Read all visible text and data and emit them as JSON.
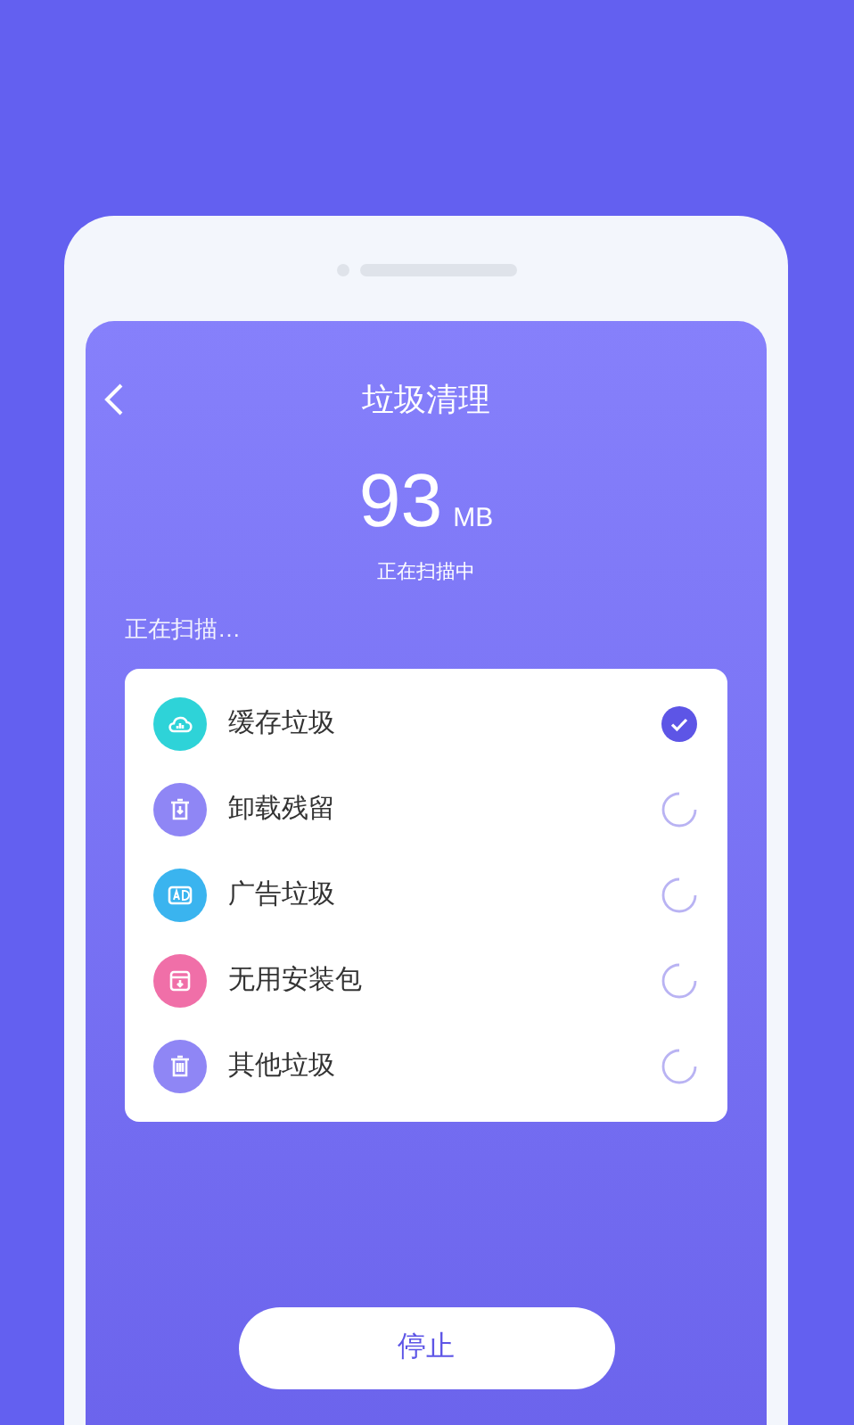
{
  "header": {
    "title": "垃圾清理"
  },
  "scan": {
    "amount": "93",
    "unit": "MB",
    "status": "正在扫描中",
    "progress_label": "正在扫描…"
  },
  "items": [
    {
      "label": "缓存垃圾",
      "kind": "cloud",
      "color": "#2ed3d8",
      "checked": true
    },
    {
      "label": "卸载残留",
      "kind": "uninstall",
      "color": "#8f86f5",
      "checked": false
    },
    {
      "label": "广告垃圾",
      "kind": "ad",
      "color": "#3ab4ef",
      "checked": false
    },
    {
      "label": "无用安装包",
      "kind": "package",
      "color": "#f06fa8",
      "checked": false
    },
    {
      "label": "其他垃圾",
      "kind": "trash",
      "color": "#8f86f5",
      "checked": false
    }
  ],
  "stop_button": "停止"
}
